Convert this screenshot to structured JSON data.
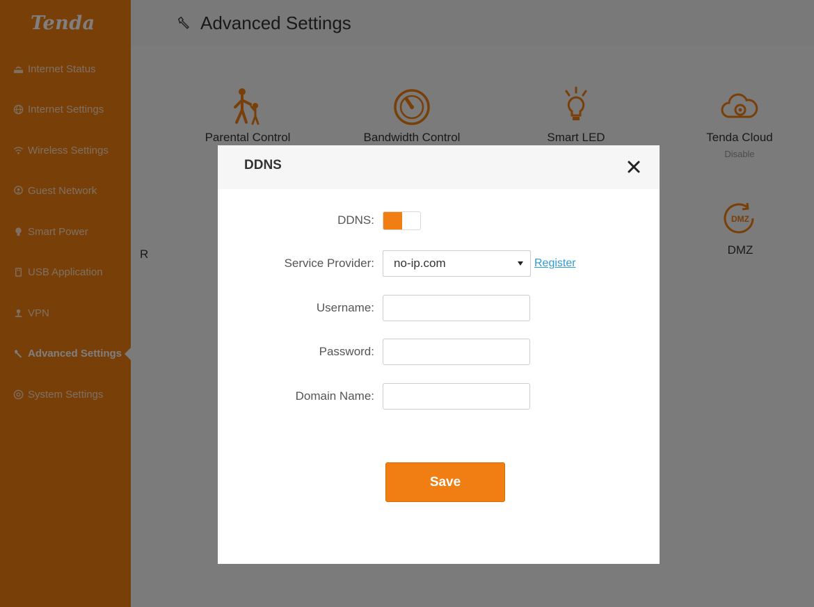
{
  "brand": {
    "logo_text": "Tenda",
    "accent_color": "#f07e12"
  },
  "sidebar": {
    "items": [
      {
        "label": "Internet Status",
        "icon": "router-icon"
      },
      {
        "label": "Internet Settings",
        "icon": "globe-icon"
      },
      {
        "label": "Wireless Settings",
        "icon": "wifi-icon"
      },
      {
        "label": "Guest Network",
        "icon": "guest-icon"
      },
      {
        "label": "Smart Power",
        "icon": "bulb-icon"
      },
      {
        "label": "USB Application",
        "icon": "usb-icon"
      },
      {
        "label": "VPN",
        "icon": "vpn-icon"
      },
      {
        "label": "Advanced Settings",
        "icon": "wrench-icon",
        "active": true
      },
      {
        "label": "System Settings",
        "icon": "gear-icon"
      }
    ]
  },
  "main": {
    "title": "Advanced Settings",
    "tiles": [
      {
        "label": "Parental Control",
        "icon": "parental-control-icon"
      },
      {
        "label": "Bandwidth Control",
        "icon": "speedometer-icon"
      },
      {
        "label": "Smart LED",
        "icon": "led-bulb-icon"
      },
      {
        "label": "Tenda Cloud",
        "sublabel": "Disable",
        "icon": "cloud-gear-icon"
      },
      {
        "label": "R",
        "icon": ""
      },
      {
        "label": "DMZ",
        "icon": "dmz-icon"
      }
    ]
  },
  "modal": {
    "title": "DDNS",
    "ddns_label": "DDNS:",
    "ddns_enabled": true,
    "provider_label": "Service Provider:",
    "provider_value": "no-ip.com",
    "register_link": "Register",
    "username_label": "Username:",
    "username_value": "",
    "password_label": "Password:",
    "password_value": "",
    "domain_label": "Domain Name:",
    "domain_value": "",
    "save_label": "Save"
  }
}
